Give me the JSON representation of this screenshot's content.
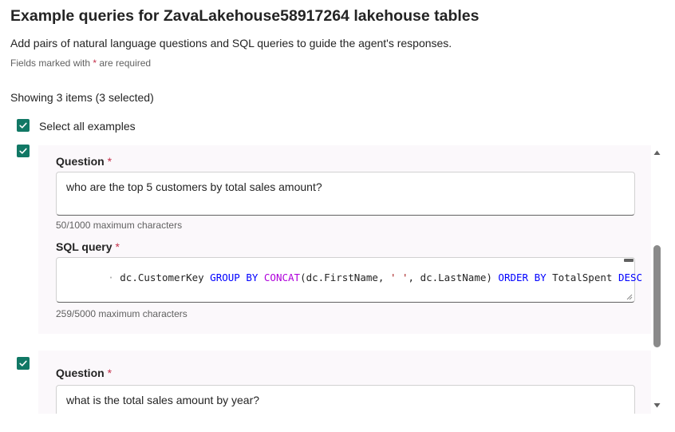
{
  "header": {
    "title": "Example queries for ZavaLakehouse58917264 lakehouse tables",
    "subtitle": "Add pairs of natural language questions and SQL queries to guide the agent's responses.",
    "required_prefix": "Fields marked with ",
    "required_star": "*",
    "required_suffix": " are required"
  },
  "list": {
    "count_text": "Showing 3 items (3 selected)",
    "select_all_label": "Select all examples",
    "select_all_checked": true
  },
  "examples": [
    {
      "checked": true,
      "question_label": "Question",
      "question_star": "*",
      "question_value": "who are the top 5 customers by total sales amount?",
      "question_hint": "50/1000 maximum characters",
      "sql_label": "SQL query",
      "sql_star": "*",
      "sql_tokens": [
        {
          "t": "dot",
          "v": "· "
        },
        {
          "t": "plain",
          "v": "dc.CustomerKey "
        },
        {
          "t": "kw",
          "v": "GROUP BY "
        },
        {
          "t": "fn",
          "v": "CONCAT"
        },
        {
          "t": "plain",
          "v": "(dc.FirstName, "
        },
        {
          "t": "str",
          "v": "' '"
        },
        {
          "t": "plain",
          "v": ", dc.LastName) "
        },
        {
          "t": "kw",
          "v": "ORDER BY "
        },
        {
          "t": "plain",
          "v": "TotalSpent "
        },
        {
          "t": "kw",
          "v": "DESC"
        }
      ],
      "sql_hint": "259/5000 maximum characters"
    },
    {
      "checked": true,
      "question_label": "Question",
      "question_star": "*",
      "question_value": "what is the total sales amount by year?"
    }
  ],
  "colors": {
    "checkbox": "#117865",
    "required": "#c4314b",
    "sql_keyword": "#0000ff",
    "sql_function": "#af00db",
    "sql_string": "#a31515"
  },
  "icons": {
    "checkbox": "checkmark-icon",
    "scroll_up": "caret-up-icon",
    "scroll_down": "caret-down-icon",
    "resize": "resize-grip-icon"
  }
}
